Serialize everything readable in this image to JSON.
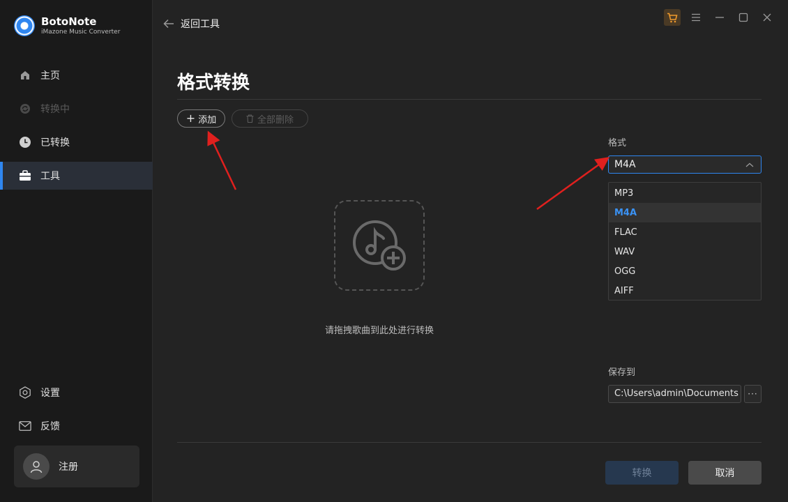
{
  "app": {
    "name": "BotoNote",
    "subtitle": "iMazone Music Converter"
  },
  "sidebar": {
    "items": [
      {
        "label": "主页",
        "icon": "home-icon",
        "state": "normal"
      },
      {
        "label": "转换中",
        "icon": "sync-icon",
        "state": "disabled"
      },
      {
        "label": "已转换",
        "icon": "clock-icon",
        "state": "normal"
      },
      {
        "label": "工具",
        "icon": "toolbox-icon",
        "state": "active"
      }
    ],
    "bottom": [
      {
        "label": "设置",
        "icon": "gear-icon"
      },
      {
        "label": "反馈",
        "icon": "mail-icon"
      }
    ],
    "user": {
      "label": "注册"
    }
  },
  "header": {
    "back_label": "返回工具"
  },
  "main": {
    "title": "格式转换",
    "add_label": "添加",
    "delete_all_label": "全部删除",
    "drop_hint": "请拖拽歌曲到此处进行转换"
  },
  "settings": {
    "format_label": "格式",
    "format_value": "M4A",
    "format_options": [
      "MP3",
      "M4A",
      "FLAC",
      "WAV",
      "OGG",
      "AIFF"
    ],
    "save_label": "保存到",
    "save_path": "C:\\Users\\admin\\Documents",
    "browse_label": "···"
  },
  "footer": {
    "convert_label": "转换",
    "cancel_label": "取消"
  },
  "colors": {
    "accent": "#2f86f0",
    "annotation": "#e0201e",
    "background": "#232323",
    "sidebar": "#1a1a1a"
  }
}
